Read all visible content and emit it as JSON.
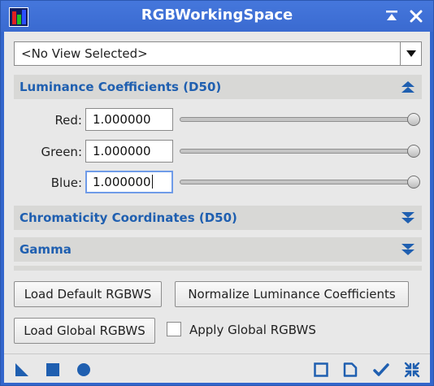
{
  "window": {
    "title": "RGBWorkingSpace",
    "accent": "#3366cc",
    "section_text_color": "#1f5fb0"
  },
  "view_selector": {
    "value": "<No View Selected>"
  },
  "sections": {
    "luminance": {
      "title": "Luminance Coefficients (D50)",
      "expanded": true
    },
    "chromaticity": {
      "title": "Chromaticity Coordinates (D50)",
      "expanded": false
    },
    "gamma": {
      "title": "Gamma",
      "expanded": false
    }
  },
  "coefficients": [
    {
      "label": "Red:",
      "value": "1.000000",
      "slider_fraction": 1.0
    },
    {
      "label": "Green:",
      "value": "1.000000",
      "slider_fraction": 1.0
    },
    {
      "label": "Blue:",
      "value": "1.000000",
      "slider_fraction": 1.0
    }
  ],
  "buttons": {
    "load_default": "Load Default RGBWS",
    "normalize": "Normalize Luminance Coefficients",
    "load_global": "Load Global RGBWS"
  },
  "apply_global": {
    "label": "Apply Global RGBWS",
    "checked": false
  },
  "icons": {
    "title_left": "app-icon",
    "title_right": [
      "shade-icon",
      "close-icon"
    ],
    "bottom_left": [
      "new-instance-icon",
      "apply-square-icon",
      "apply-global-circle-icon"
    ],
    "bottom_right": [
      "preview-icon",
      "document-icon",
      "check-icon",
      "reset-icon"
    ]
  }
}
